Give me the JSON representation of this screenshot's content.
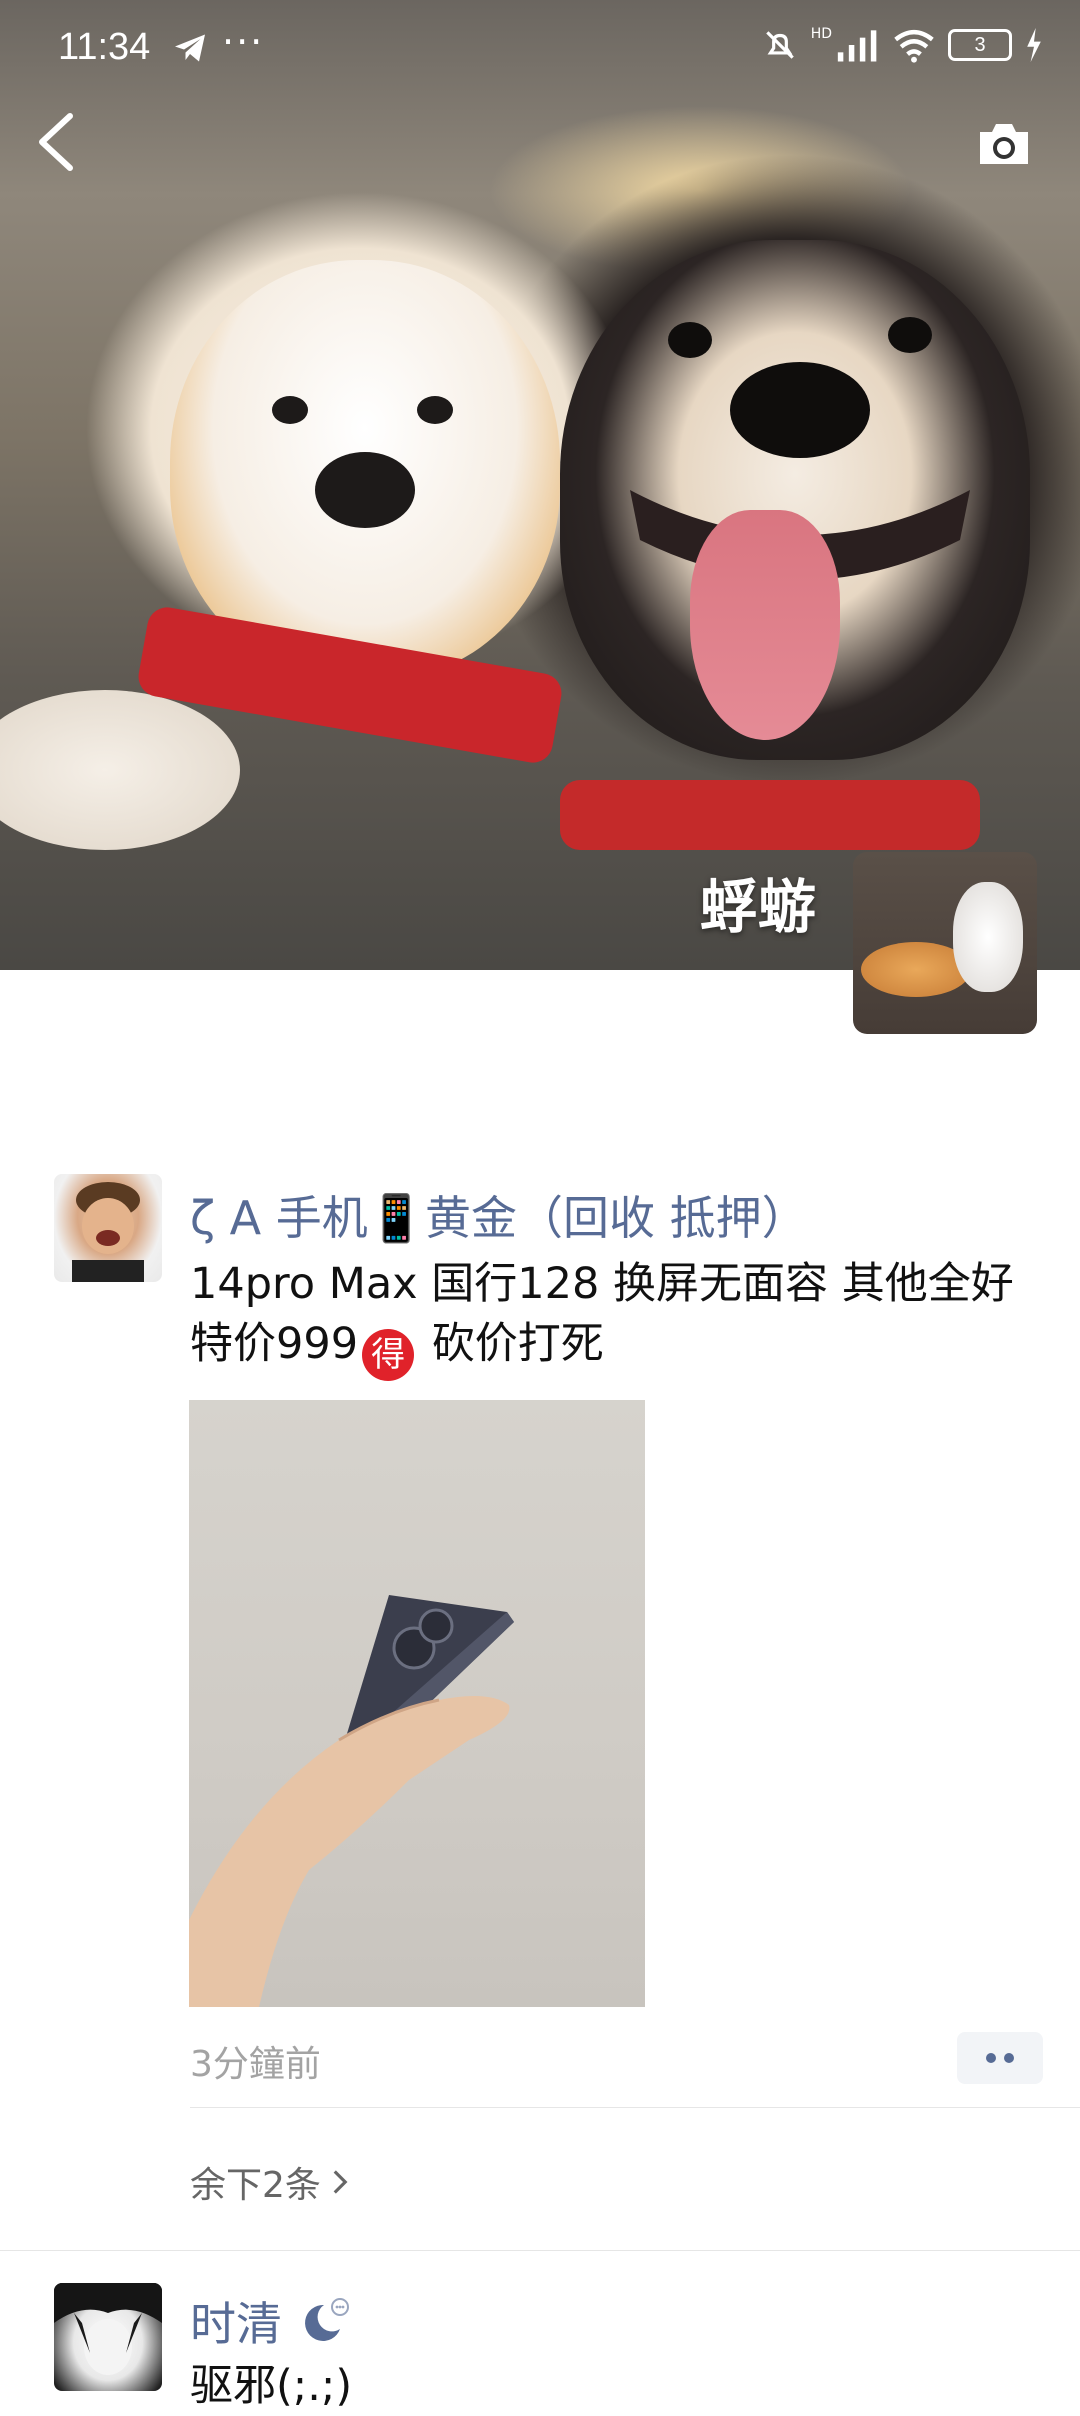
{
  "status_bar": {
    "time": "11:34",
    "more": "···",
    "battery": "3",
    "signal_label": "HD"
  },
  "cover": {
    "name": "蜉蝣"
  },
  "posts": [
    {
      "author": "ζ Α 手机📱黄金（回收 抵押）",
      "text_line1": "14pro Max 国行128 换屏无面容 其他全好",
      "text_line2_a": "特价999",
      "badge": "得",
      "text_line2_b": " 砍价打死",
      "time": "3分鐘前",
      "remaining": "余下2条"
    },
    {
      "author": "时清",
      "text": "驱邪(;.;)"
    }
  ],
  "colors": {
    "name_link": "#576b95",
    "badge_red": "#e0222a"
  }
}
